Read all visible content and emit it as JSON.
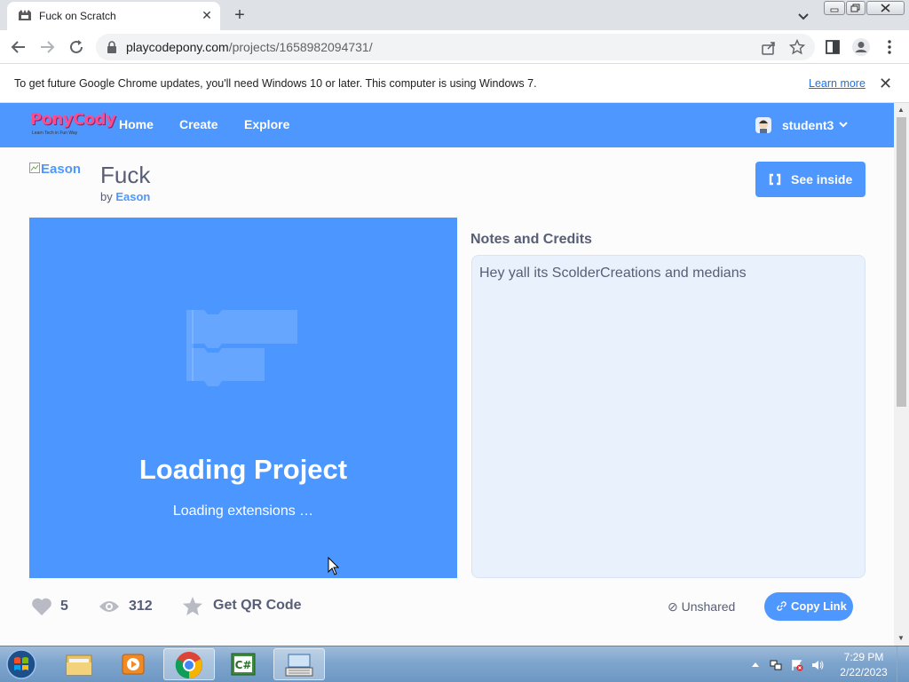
{
  "browser": {
    "tab_title": "Fuck on Scratch",
    "new_tab": "+",
    "tab_close": "✕",
    "url_host": "playcodepony.com",
    "url_path": "/projects/1658982094731/",
    "window_buttons": [
      "minimize",
      "restore",
      "close"
    ]
  },
  "infobar": {
    "message": "To get future Google Chrome updates, you'll need Windows 10 or later. This computer is using Windows 7.",
    "learn_more": "Learn more",
    "close": "✕"
  },
  "site": {
    "logo_text": "PonyCody",
    "logo_tagline": "Learn Tech in Fun Way",
    "nav": [
      "Home",
      "Create",
      "Explore"
    ],
    "username": "student3"
  },
  "project": {
    "author_image_alt": "Eason",
    "title": "Fuck",
    "by_label": "by",
    "author": "Eason",
    "see_inside": "See inside",
    "loading_title": "Loading Project",
    "loading_subtitle": "Loading extensions …",
    "notes_heading": "Notes and Credits",
    "notes_text": "Hey yall its ScolderCreations and medians",
    "loves": "5",
    "views": "312",
    "qr_label": "Get QR Code",
    "unshared": "⊘ Unshared",
    "copy_link": "Copy Link"
  },
  "taskbar": {
    "apps": [
      "windows-explorer",
      "media-player",
      "chrome",
      "csharp-ide",
      "on-screen-keyboard"
    ],
    "time": "7:29 PM",
    "date": "2/22/2023"
  },
  "colors": {
    "brand_blue": "#4d97ff",
    "stage_blue": "#4c97ff",
    "text_gray": "#575e75"
  }
}
